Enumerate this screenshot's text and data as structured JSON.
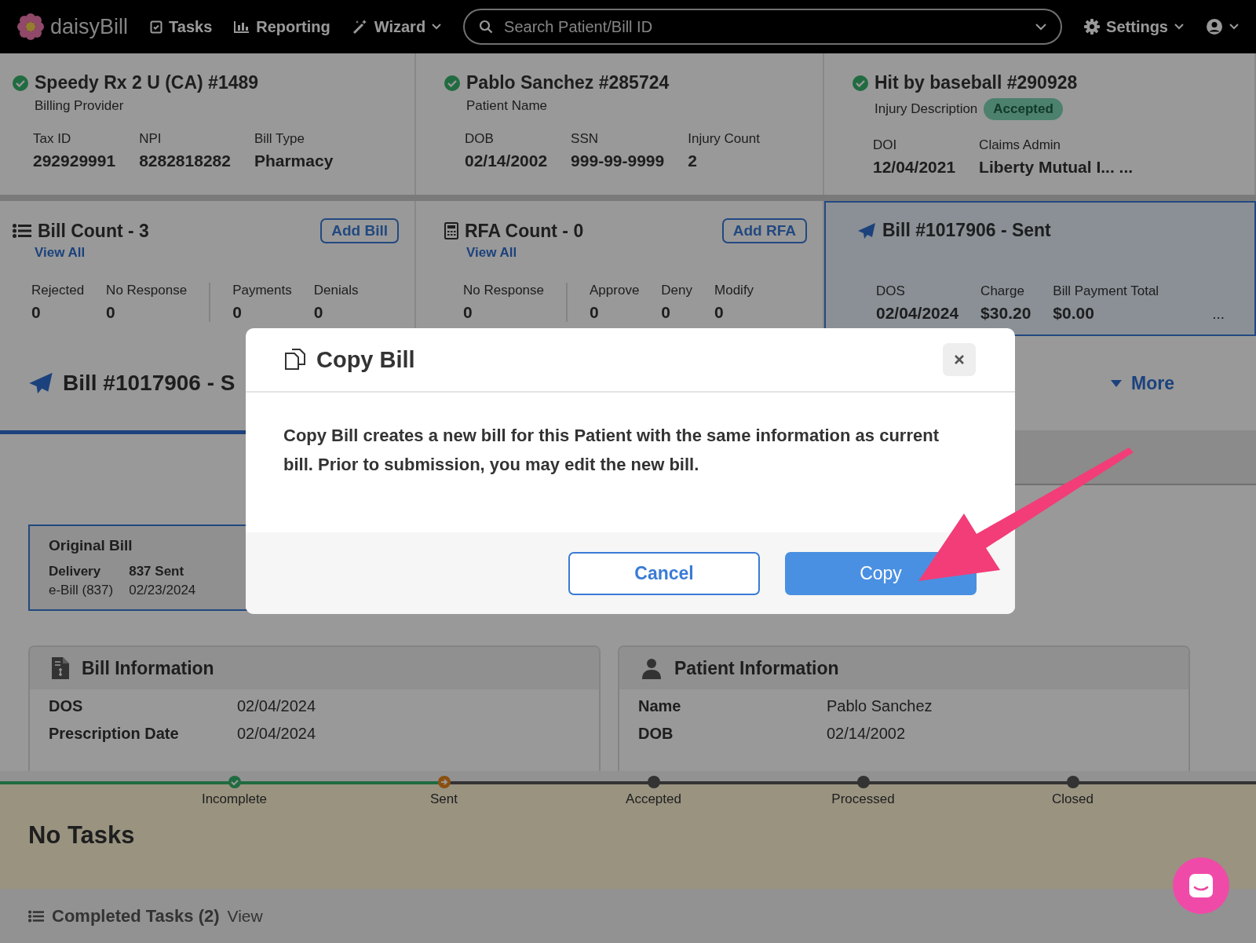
{
  "nav": {
    "logo": "daisyBill",
    "items": [
      {
        "label": "Tasks",
        "kind": "tasks",
        "dropdown": false
      },
      {
        "label": "Reporting",
        "kind": "reporting",
        "dropdown": false
      },
      {
        "label": "Wizard",
        "kind": "wizard",
        "dropdown": true
      }
    ],
    "search": {
      "placeholder": "Search Patient/Bill ID"
    },
    "settings": "Settings"
  },
  "summary": [
    {
      "title": "Speedy Rx 2 U (CA) #1489",
      "subtitle": "Billing Provider",
      "fields": [
        {
          "label": "Tax ID",
          "value": "292929991"
        },
        {
          "label": "NPI",
          "value": "8282818282"
        },
        {
          "label": "Bill Type",
          "value": "Pharmacy"
        }
      ]
    },
    {
      "title": "Pablo Sanchez #285724",
      "subtitle": "Patient Name",
      "fields": [
        {
          "label": "DOB",
          "value": "02/14/2002"
        },
        {
          "label": "SSN",
          "value": "999-99-9999"
        },
        {
          "label": "Injury Count",
          "value": "2"
        }
      ]
    },
    {
      "title": "Hit by baseball #290928",
      "subtitle": "Injury Description",
      "badge": "Accepted",
      "fields": [
        {
          "label": "DOI",
          "value": "12/04/2021"
        },
        {
          "label": "Claims Admin",
          "value": "Liberty Mutual I... ..."
        }
      ]
    }
  ],
  "counts": [
    {
      "kind": "list",
      "title": "Bill Count - 3",
      "action": "Add Bill",
      "link": "View All",
      "groups": [
        [
          {
            "label": "Rejected",
            "value": "0"
          },
          {
            "label": "No Response",
            "value": "0"
          }
        ],
        [
          {
            "label": "Payments",
            "value": "0"
          },
          {
            "label": "Denials",
            "value": "0"
          }
        ]
      ]
    },
    {
      "kind": "calc",
      "title": "RFA Count - 0",
      "action": "Add RFA",
      "link": "View All",
      "groups": [
        [
          {
            "label": "No Response",
            "value": "0"
          }
        ],
        [
          {
            "label": "Approve",
            "value": "0"
          },
          {
            "label": "Deny",
            "value": "0"
          },
          {
            "label": "Modify",
            "value": "0"
          }
        ]
      ]
    }
  ],
  "current_bill": {
    "title": "Bill #1017906 - Sent",
    "fields": [
      {
        "label": "DOS",
        "value": "02/04/2024"
      },
      {
        "label": "Charge",
        "value": "$30.20"
      },
      {
        "label": "Bill Payment Total",
        "value": "$0.00"
      }
    ],
    "more": "..."
  },
  "bill_heading": {
    "title": "Bill #1017906 - S",
    "more": "More"
  },
  "original_bill": {
    "title": "Original Bill",
    "rows": [
      [
        "Delivery",
        "837 Sent"
      ],
      [
        "e-Bill (837)",
        "02/23/2024"
      ]
    ]
  },
  "info_cards": [
    {
      "kind": "bill",
      "title": "Bill Information",
      "rows": [
        {
          "label": "DOS",
          "value": "02/04/2024"
        },
        {
          "label": "Prescription Date",
          "value": "02/04/2024"
        }
      ]
    },
    {
      "kind": "patient",
      "title": "Patient Information",
      "rows": [
        {
          "label": "Name",
          "value": "Pablo Sanchez"
        },
        {
          "label": "DOB",
          "value": "02/14/2002"
        }
      ]
    }
  ],
  "progress": [
    {
      "label": "Incomplete",
      "completed": true,
      "current": false
    },
    {
      "label": "Sent",
      "completed": false,
      "current": true
    },
    {
      "label": "Accepted",
      "completed": false,
      "current": false
    },
    {
      "label": "Processed",
      "completed": false,
      "current": false
    },
    {
      "label": "Closed",
      "completed": false,
      "current": false
    }
  ],
  "tasks": {
    "title": "No Tasks",
    "completed": "Completed Tasks (2)",
    "view": "View"
  },
  "modal": {
    "title": "Copy Bill",
    "body": "Copy Bill creates a new bill for this Patient with the same information as current bill. Prior to submission, you may edit the new bill.",
    "buttons": [
      {
        "label": "Cancel",
        "kind": "secondary"
      },
      {
        "label": "Copy",
        "kind": "primary"
      }
    ]
  }
}
